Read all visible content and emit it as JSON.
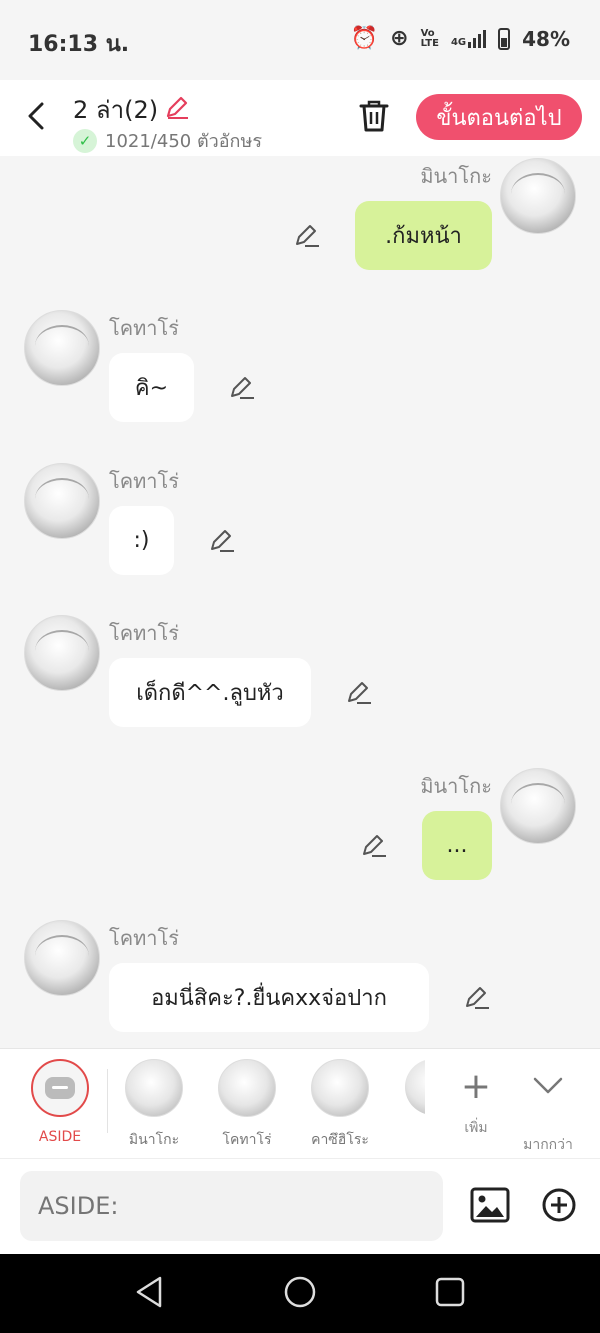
{
  "status": {
    "time": "16:13 น.",
    "battery": "48%",
    "net_top": "Vo",
    "net_bottom": "LTE",
    "signal": "4G"
  },
  "header": {
    "title": "2 ล่า(2)",
    "count": "1021/450 ตัวอักษร",
    "next_label": "ขั้นตอนต่อไป"
  },
  "messages": [
    {
      "name": "มินาโกะ",
      "text": ".ก้มหน้า"
    },
    {
      "name": "โคทาโร่",
      "text": "คิ~"
    },
    {
      "name": "โคทาโร่",
      "text": ":)"
    },
    {
      "name": "โคทาโร่",
      "text": "เด็กดี^^.ลูบหัว"
    },
    {
      "name": "มินาโกะ",
      "text": "..."
    },
    {
      "name": "โคทาโร่",
      "text": "อมนี่สิคะ?.ยื่นคxxจ่อปาก"
    }
  ],
  "characters": [
    {
      "label": "ASIDE"
    },
    {
      "label": "มินาโกะ"
    },
    {
      "label": "โคทาโร่"
    },
    {
      "label": "คาซึฮิโระ"
    }
  ],
  "actions": {
    "add_label": "เพิ่ม",
    "more_label": "มากกว่า"
  },
  "input": {
    "placeholder": "ASIDE:"
  }
}
